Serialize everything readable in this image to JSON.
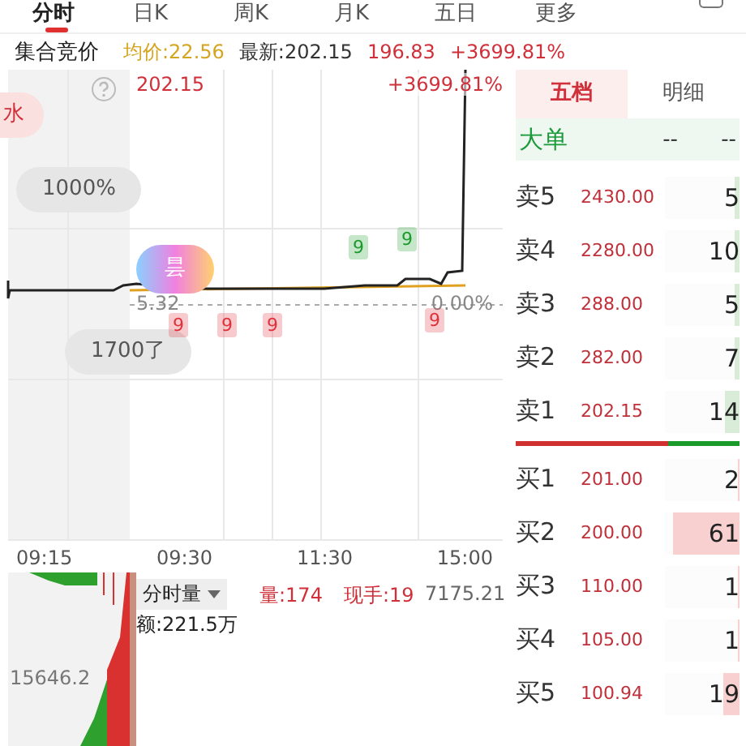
{
  "tabs": [
    {
      "label": "分时",
      "selected": true
    },
    {
      "label": "日K",
      "selected": false
    },
    {
      "label": "周K",
      "selected": false
    },
    {
      "label": "月K",
      "selected": false
    },
    {
      "label": "五日",
      "selected": false
    },
    {
      "label": "更多",
      "selected": false
    }
  ],
  "quote_bar": {
    "session": "集合竞价",
    "average": "均价:22.56",
    "latest": "最新:202.15",
    "price": "196.83",
    "change": "+3699.81%"
  },
  "chart": {
    "high_price": "202.15",
    "high_change": "+3699.81%",
    "base_price": "5.32",
    "base_change": "0.00%",
    "pills": [
      {
        "label": "水",
        "kind": "alert"
      },
      {
        "label": "1000%",
        "kind": "plain"
      },
      {
        "label": "1700了",
        "kind": "plain"
      }
    ],
    "bubble": "昙",
    "markers": [
      {
        "label": "9",
        "color": "#e0303a"
      },
      {
        "label": "9",
        "color": "#e0303a"
      },
      {
        "label": "9",
        "color": "#e0303a"
      },
      {
        "label": "9",
        "color": "#1a9a2a"
      },
      {
        "label": "9",
        "color": "#1a9a2a"
      },
      {
        "label": "9",
        "color": "#e0303a"
      }
    ],
    "times": [
      "09:15",
      "09:30",
      "11:30",
      "15:00"
    ]
  },
  "volume": {
    "selector": "分时量",
    "volume": "量:174",
    "hand": "现手:19",
    "max": "7175.21",
    "amount": "额:221.5万",
    "mid": "15646.2"
  },
  "order_book": {
    "tabs": [
      {
        "label": "五档",
        "selected": true
      },
      {
        "label": "明细",
        "selected": false
      }
    ],
    "big_order": {
      "label": "大单",
      "col_1": "--",
      "col_2": "--"
    },
    "asks": [
      {
        "label": "卖5",
        "price": "2430.00",
        "qty": "5",
        "level": 0.06
      },
      {
        "label": "卖4",
        "price": "2280.00",
        "qty": "10",
        "level": 0.06
      },
      {
        "label": "卖3",
        "price": "288.00",
        "qty": "5",
        "level": 0.06
      },
      {
        "label": "卖2",
        "price": "282.00",
        "qty": "7",
        "level": 0.06
      },
      {
        "label": "卖1",
        "price": "202.15",
        "qty": "14",
        "level": 0.2
      }
    ],
    "buy_sell_bar": {
      "level": 0.68
    },
    "bids": [
      {
        "label": "买1",
        "price": "201.00",
        "qty": "2",
        "level": 0.02
      },
      {
        "label": "买2",
        "price": "200.00",
        "qty": "61",
        "level": 0.9
      },
      {
        "label": "买3",
        "price": "110.00",
        "qty": "1",
        "level": 0.02
      },
      {
        "label": "买4",
        "price": "105.00",
        "qty": "1",
        "level": 0.02
      },
      {
        "label": "买5",
        "price": "100.94",
        "qty": "19",
        "level": 0.22
      }
    ]
  }
}
